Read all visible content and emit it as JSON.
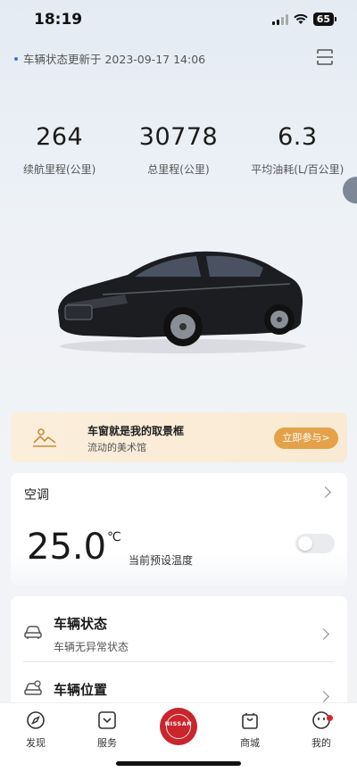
{
  "status": {
    "time": "18:19",
    "battery": "65"
  },
  "header": {
    "update_text": "车辆状态更新于 2023-09-17 14:06"
  },
  "stats": [
    {
      "value": "264",
      "label": "续航里程(公里)"
    },
    {
      "value": "30778",
      "label": "总里程(公里)"
    },
    {
      "value": "6.3",
      "label": "平均油耗(L/百公里)"
    }
  ],
  "banner": {
    "title": "车窗就是我的取景框",
    "subtitle": "流动的美术馆",
    "button": "立即参与>"
  },
  "ac": {
    "title": "空调",
    "temperature": "25.0",
    "unit": "℃",
    "label": "当前预设温度",
    "power_on": false
  },
  "vehicle": [
    {
      "title": "车辆状态",
      "subtitle": "车辆无异常状态"
    },
    {
      "title": "车辆位置"
    }
  ],
  "tabs": [
    "发现",
    "服务",
    "NISSAN",
    "商城",
    "我的"
  ],
  "icons": {
    "scan": "scan-icon",
    "banner": "landscape-icon",
    "discover": "compass-icon",
    "service": "service-icon",
    "mall": "shopping-bag-icon",
    "mine": "smiley-icon"
  },
  "colors": {
    "accent": "#c9252c",
    "banner_button": "#e3a24a"
  }
}
